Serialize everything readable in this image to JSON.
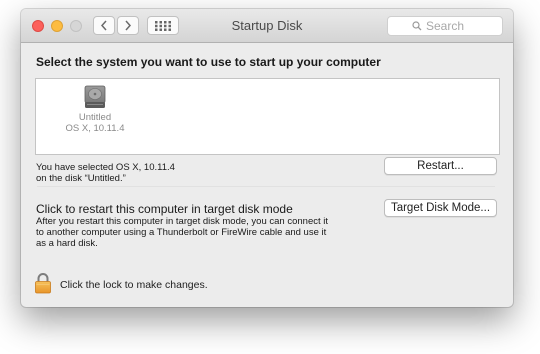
{
  "window": {
    "title": "Startup Disk",
    "search_placeholder": "Search"
  },
  "heading": "Select the system you want to use to start up your computer",
  "disks": [
    {
      "name": "Untitled",
      "os": "OS X, 10.11.4",
      "icon": "hard-disk-icon"
    }
  ],
  "selection": {
    "line1": "You have selected OS X, 10.11.4",
    "line2": "on the disk “Untitled.”",
    "restart_label": "Restart..."
  },
  "target_mode": {
    "title": "Click to restart this computer in target disk mode",
    "description": "After you restart this computer in target disk mode, you can connect it to another computer using a Thunderbolt or FireWire cable and use it as a hard disk.",
    "button_label": "Target Disk Mode..."
  },
  "lock": {
    "text": "Click the lock to make changes.",
    "icon": "padlock-icon",
    "color": "#f0a431"
  },
  "colors": {
    "close": "#fc605b",
    "minimize": "#fdbc40",
    "zoom_disabled": "#d6d6d6"
  }
}
